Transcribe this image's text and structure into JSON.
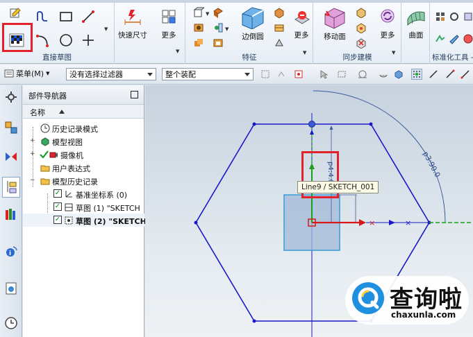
{
  "ribbon": {
    "groups": {
      "sketch": {
        "label": "直接草图"
      },
      "feature": {
        "label": "特征"
      },
      "sync": {
        "label": "同步建模"
      },
      "standard": {
        "label": "标准化工具 -"
      }
    },
    "buttons": {
      "rapid_dimension": "快速尺寸",
      "more_sketch": "更多",
      "edge_blend": "边倒圆",
      "more_feature": "更多",
      "move_face": "移动面",
      "more_sync": "更多",
      "surface": "曲面"
    }
  },
  "toolbar": {
    "menu_label": "菜单(M)",
    "filter_value": "没有选择过滤器",
    "assembly_value": "整个装配"
  },
  "navigator": {
    "title": "部件导航器",
    "column_name": "名称",
    "items": [
      {
        "label": "历史记录模式"
      },
      {
        "label": "模型视图"
      },
      {
        "label": "摄像机"
      },
      {
        "label": "用户表达式"
      },
      {
        "label": "模型历史记录"
      },
      {
        "label": "基准坐标系 (0)"
      },
      {
        "label": "草图 (1) \"SKETCH"
      },
      {
        "label": "草图 (2) \"SKETCH"
      }
    ]
  },
  "canvas": {
    "tooltip": "Line9 / SKETCH_001",
    "dim_vertical": "p4:4.0",
    "dim_diameter": "p3:90.0"
  },
  "watermark": {
    "brand_cn": "查询啦",
    "brand_en": "chaxunla.com"
  },
  "colors": {
    "highlight": "#e3212a",
    "sketch_blue": "#1818c8",
    "axis_green": "#18a018",
    "axis_red": "#d81818"
  }
}
